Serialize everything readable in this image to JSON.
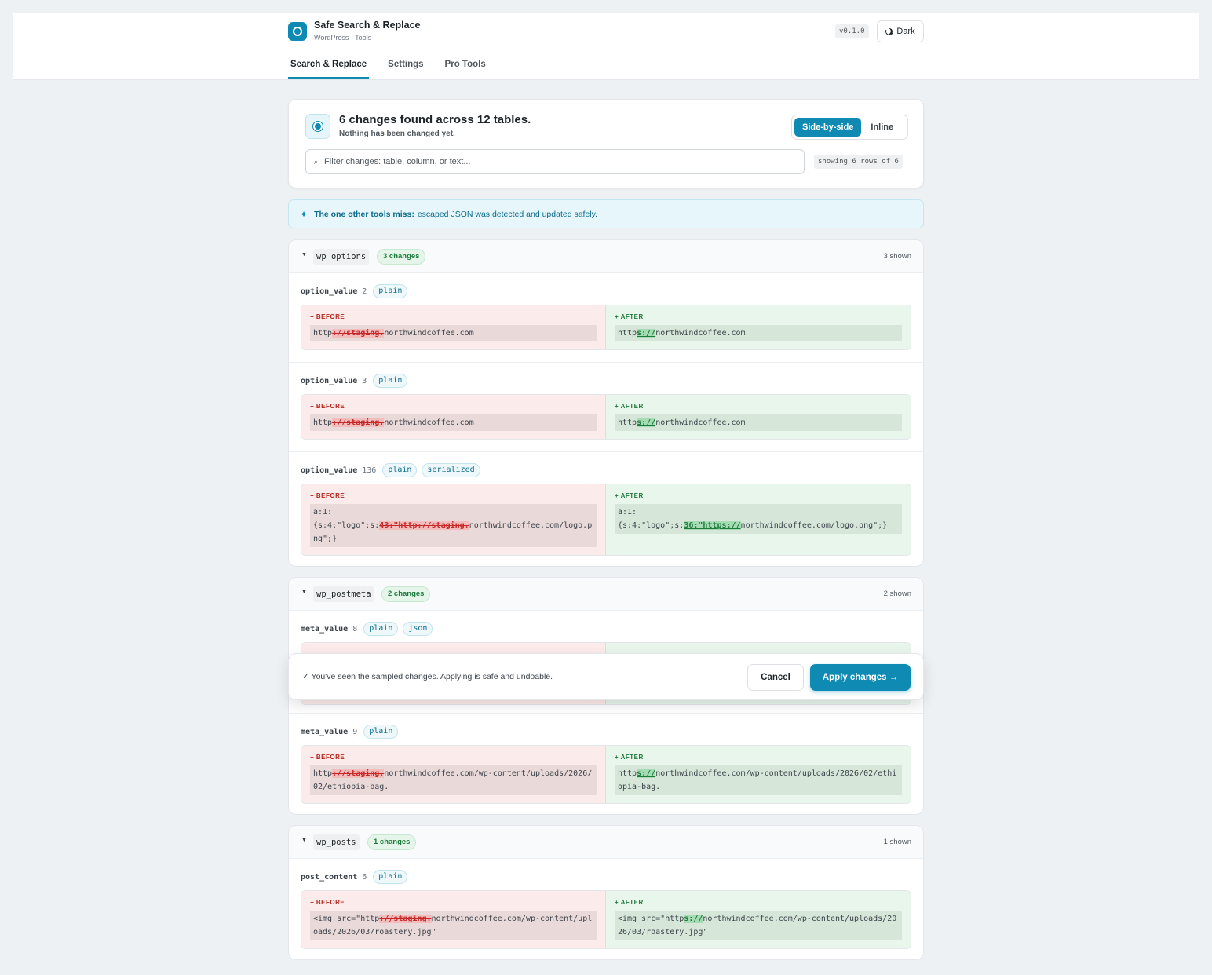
{
  "app": {
    "title": "Safe Search & Replace",
    "subtitle": "WordPress · Tools",
    "version": "v0.1.0",
    "dark_label": "Dark"
  },
  "tabs": [
    "Search & Replace",
    "Settings",
    "Pro Tools"
  ],
  "summary": {
    "title": "6 changes found across 12 tables.",
    "subtitle": "Nothing has been changed yet.",
    "view_options": [
      "Side-by-side",
      "Inline"
    ],
    "filter_placeholder": "Filter changes: table, column, or text...",
    "showing": "showing 6 rows of 6"
  },
  "callout": {
    "strong": "The one other tools miss:",
    "text": "escaped JSON was detected and updated safely."
  },
  "labels": {
    "before": "− BEFORE",
    "after": "+ AFTER"
  },
  "groups": [
    {
      "table": "wp_options",
      "changes": "3 changes",
      "shown": "3 shown",
      "rows": [
        {
          "column": "option_value",
          "id": "2",
          "pills": [
            "plain"
          ],
          "before": {
            "pre": "http",
            "del": "://staging.",
            "post": "northwindcoffee.com"
          },
          "after": {
            "pre": "http",
            "ins": "s://",
            "post": "northwindcoffee.com"
          }
        },
        {
          "column": "option_value",
          "id": "3",
          "pills": [
            "plain"
          ],
          "before": {
            "pre": "http",
            "del": "://staging.",
            "post": "northwindcoffee.com"
          },
          "after": {
            "pre": "http",
            "ins": "s://",
            "post": "northwindcoffee.com"
          }
        },
        {
          "column": "option_value",
          "id": "136",
          "pills": [
            "plain",
            "serialized"
          ],
          "before": {
            "pre": "a:1:\n{s:4:\"logo\";s:",
            "del": "43:\"http://staging.",
            "post": "northwindcoffee.com/logo.png\";}"
          },
          "after": {
            "pre": "a:1:\n{s:4:\"logo\";s:",
            "ins": "36:\"https://",
            "post": "northwindcoffee.com/logo.png\";}"
          }
        }
      ]
    },
    {
      "table": "wp_postmeta",
      "changes": "2 changes",
      "shown": "2 shown",
      "rows": [
        {
          "column": "meta_value",
          "id": "8",
          "pills": [
            "plain",
            "json"
          ]
        },
        {
          "column": "meta_value",
          "id": "9",
          "pills": [
            "plain"
          ],
          "before": {
            "pre": "http",
            "del": "://staging.",
            "post": "northwindcoffee.com/wp-content/uploads/2026/02/ethiopia-bag."
          },
          "after": {
            "pre": "http",
            "ins": "s://",
            "post": "northwindcoffee.com/wp-content/uploads/2026/02/ethiopia-bag."
          }
        }
      ]
    },
    {
      "table": "wp_posts",
      "changes": "1 changes",
      "shown": "1 shown",
      "rows": [
        {
          "column": "post_content",
          "id": "6",
          "pills": [
            "plain"
          ],
          "before": {
            "pre": "<img src=\"http",
            "del": "://staging.",
            "post": "northwindcoffee.com/wp-content/uploads/2026/03/roastery.jpg\""
          },
          "after": {
            "pre": "<img src=\"http",
            "ins": "s://",
            "post": "northwindcoffee.com/wp-content/uploads/2026/03/roastery.jpg\""
          }
        }
      ]
    }
  ],
  "apply_bar": {
    "message": "✓ You've seen the sampled changes. Applying is safe and undoable.",
    "cancel": "Cancel",
    "apply": "Apply changes →"
  }
}
